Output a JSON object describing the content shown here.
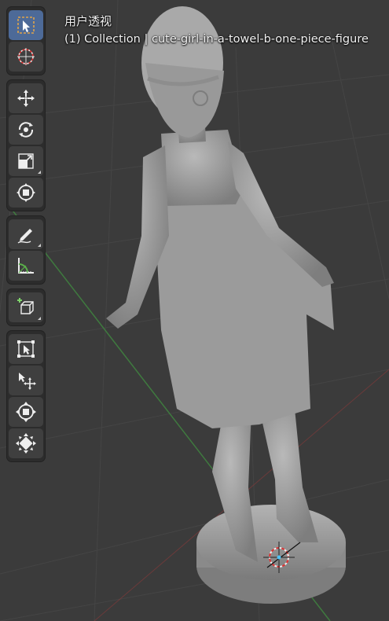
{
  "viewport": {
    "title": "用户透视",
    "subtitle": "(1) Collection | cute-girl-in-a-towel-b-one-piece-figure",
    "background": "#3b3b3b",
    "grid_color": "#444444",
    "axis_x_color": "#8a3a3a",
    "axis_y_color": "#3f7a3f",
    "model_color": "#a4a4a4"
  },
  "toolbar": {
    "groups": [
      {
        "tools": [
          {
            "icon": "select-box-icon",
            "active": true
          },
          {
            "icon": "cursor-icon",
            "active": false
          }
        ]
      },
      {
        "tools": [
          {
            "icon": "move-icon"
          },
          {
            "icon": "rotate-icon"
          },
          {
            "icon": "scale-icon"
          },
          {
            "icon": "transform-icon"
          }
        ]
      },
      {
        "tools": [
          {
            "icon": "annotate-icon"
          },
          {
            "icon": "measure-icon"
          }
        ]
      },
      {
        "tools": [
          {
            "icon": "add-cube-icon"
          }
        ]
      },
      {
        "tools": [
          {
            "icon": "select-frame-icon"
          },
          {
            "icon": "shift-move-icon"
          },
          {
            "icon": "push-pull-icon"
          },
          {
            "icon": "randomize-icon"
          }
        ]
      }
    ]
  }
}
